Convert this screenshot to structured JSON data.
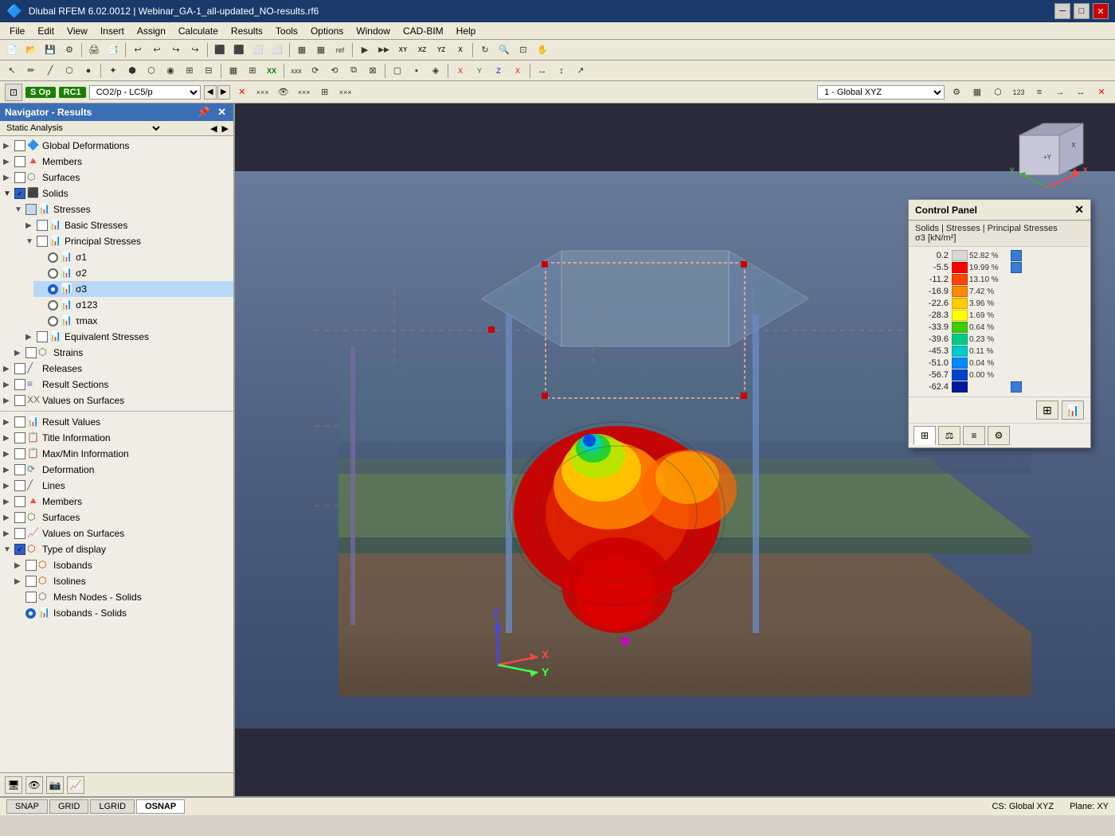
{
  "window": {
    "title": "Dlubal RFEM 6.02.0012 | Webinar_GA-1_all-updated_NO-results.rf6"
  },
  "menubar": {
    "items": [
      "File",
      "Edit",
      "View",
      "Insert",
      "Assign",
      "Calculate",
      "Results",
      "Tools",
      "Options",
      "Window",
      "CAD-BIM",
      "Help"
    ]
  },
  "loadbar": {
    "badge1": "S Op",
    "badge2": "RC1",
    "combo": "CO2/p - LC5/p",
    "dropdown_label": "1 - Global XYZ"
  },
  "navigator": {
    "title": "Navigator - Results",
    "dropdown": "Static Analysis",
    "tree": [
      {
        "id": "global-deformations",
        "label": "Global Deformations",
        "indent": 0,
        "expand": true,
        "checked": false,
        "type": "checkbox-folder"
      },
      {
        "id": "members",
        "label": "Members",
        "indent": 0,
        "expand": true,
        "checked": false,
        "type": "checkbox-folder"
      },
      {
        "id": "surfaces",
        "label": "Surfaces",
        "indent": 0,
        "expand": true,
        "checked": false,
        "type": "checkbox-folder"
      },
      {
        "id": "solids",
        "label": "Solids",
        "indent": 0,
        "expand": true,
        "checked": true,
        "type": "checkbox-folder"
      },
      {
        "id": "stresses",
        "label": "Stresses",
        "indent": 1,
        "expand": true,
        "checked": true,
        "type": "checkbox-folder"
      },
      {
        "id": "basic-stresses",
        "label": "Basic Stresses",
        "indent": 2,
        "expand": true,
        "checked": false,
        "type": "checkbox-folder"
      },
      {
        "id": "principal-stresses",
        "label": "Principal Stresses",
        "indent": 2,
        "expand": true,
        "checked": false,
        "type": "checkbox-folder"
      },
      {
        "id": "sigma1",
        "label": "σ1",
        "indent": 3,
        "radio": "off",
        "type": "radio"
      },
      {
        "id": "sigma2",
        "label": "σ2",
        "indent": 3,
        "radio": "off",
        "type": "radio"
      },
      {
        "id": "sigma3",
        "label": "σ3",
        "indent": 3,
        "radio": "on",
        "type": "radio"
      },
      {
        "id": "sigma123",
        "label": "σ123",
        "indent": 3,
        "radio": "off",
        "type": "radio"
      },
      {
        "id": "tmax",
        "label": "τmax",
        "indent": 3,
        "radio": "off",
        "type": "radio"
      },
      {
        "id": "equivalent-stresses",
        "label": "Equivalent Stresses",
        "indent": 2,
        "expand": true,
        "checked": false,
        "type": "checkbox-folder"
      },
      {
        "id": "strains",
        "label": "Strains",
        "indent": 1,
        "expand": true,
        "checked": false,
        "type": "checkbox-folder"
      },
      {
        "id": "releases",
        "label": "Releases",
        "indent": 0,
        "expand": true,
        "checked": false,
        "type": "checkbox-folder"
      },
      {
        "id": "result-sections",
        "label": "Result Sections",
        "indent": 0,
        "expand": true,
        "checked": false,
        "type": "checkbox-folder"
      },
      {
        "id": "values-on-surfaces",
        "label": "Values on Surfaces",
        "indent": 0,
        "expand": false,
        "checked": false,
        "type": "checkbox-folder"
      }
    ],
    "tree2": [
      {
        "id": "result-values",
        "label": "Result Values",
        "indent": 0,
        "checked": false,
        "type": "checkbox-folder"
      },
      {
        "id": "title-information",
        "label": "Title Information",
        "indent": 0,
        "checked": false,
        "type": "checkbox-folder"
      },
      {
        "id": "maxmin-information",
        "label": "Max/Min Information",
        "indent": 0,
        "checked": false,
        "type": "checkbox-folder"
      },
      {
        "id": "deformation",
        "label": "Deformation",
        "indent": 0,
        "checked": false,
        "type": "checkbox-folder"
      },
      {
        "id": "lines",
        "label": "Lines",
        "indent": 0,
        "checked": false,
        "type": "checkbox-folder"
      },
      {
        "id": "members-2",
        "label": "Members",
        "indent": 0,
        "checked": false,
        "type": "checkbox-folder"
      },
      {
        "id": "surfaces-2",
        "label": "Surfaces",
        "indent": 0,
        "checked": false,
        "type": "checkbox-folder"
      },
      {
        "id": "values-on-surfaces-2",
        "label": "Values on Surfaces",
        "indent": 0,
        "checked": false,
        "type": "checkbox-folder"
      },
      {
        "id": "type-of-display",
        "label": "Type of display",
        "indent": 0,
        "expand": true,
        "checked": true,
        "type": "checkbox-folder"
      },
      {
        "id": "isobands",
        "label": "Isobands",
        "indent": 1,
        "expand": true,
        "checked": false,
        "type": "checkbox-folder"
      },
      {
        "id": "isolines",
        "label": "Isolines",
        "indent": 1,
        "expand": true,
        "checked": false,
        "type": "checkbox-folder"
      },
      {
        "id": "mesh-nodes-solids",
        "label": "Mesh Nodes - Solids",
        "indent": 1,
        "checked": false,
        "type": "checkbox-folder"
      },
      {
        "id": "isobands-solids",
        "label": "Isobands - Solids",
        "indent": 1,
        "radio": "on",
        "type": "radio-selected"
      }
    ]
  },
  "control_panel": {
    "title": "Control Panel",
    "subtitle1": "Solids | Stresses | Principal Stresses",
    "subtitle2": "σ3 [kN/m²]",
    "legend": [
      {
        "value": "0.2",
        "color": "#d8d8d8",
        "pct": "52.82 %",
        "indicator": true
      },
      {
        "value": "-5.5",
        "color": "#ff0000",
        "pct": "19.99 %",
        "indicator": true
      },
      {
        "value": "-11.2",
        "color": "#ff4400",
        "pct": "13.10 %",
        "indicator": false
      },
      {
        "value": "-16.9",
        "color": "#ff8800",
        "pct": "7.42 %",
        "indicator": false
      },
      {
        "value": "-22.6",
        "color": "#ffcc00",
        "pct": "3.96 %",
        "indicator": false
      },
      {
        "value": "-28.3",
        "color": "#ffff00",
        "pct": "1.69 %",
        "indicator": false
      },
      {
        "value": "-33.9",
        "color": "#44cc00",
        "pct": "0.64 %",
        "indicator": false
      },
      {
        "value": "-39.6",
        "color": "#00cc88",
        "pct": "0.23 %",
        "indicator": false
      },
      {
        "value": "-45.3",
        "color": "#00cccc",
        "pct": "0.11 %",
        "indicator": false
      },
      {
        "value": "-51.0",
        "color": "#0088ff",
        "pct": "0.04 %",
        "indicator": false
      },
      {
        "value": "-56.7",
        "color": "#0044cc",
        "pct": "0.00 %",
        "indicator": false
      },
      {
        "value": "-62.4",
        "color": "#001a99",
        "pct": "",
        "indicator": true
      }
    ]
  },
  "statusbar": {
    "items": [
      "SNAP",
      "GRID",
      "LGRID",
      "OSNAP"
    ],
    "active": "OSNAP",
    "cs": "CS: Global XYZ",
    "plane": "Plane: XY"
  }
}
